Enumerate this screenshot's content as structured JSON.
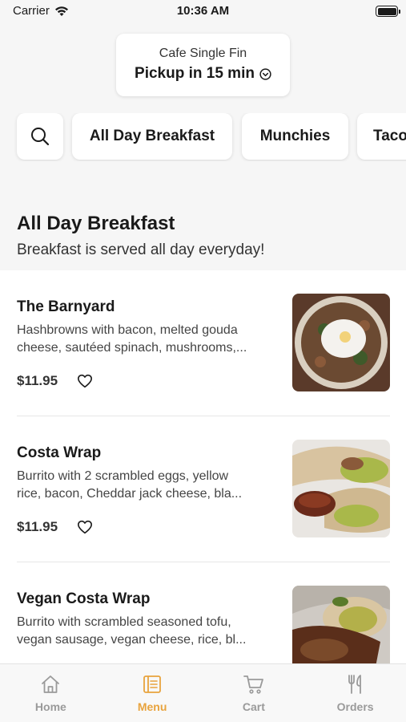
{
  "status": {
    "carrier": "Carrier",
    "time": "10:36 AM"
  },
  "location": {
    "name": "Cafe Single Fin",
    "pickup": "Pickup in 15 min"
  },
  "categories": [
    "All Day Breakfast",
    "Munchies",
    "Tacos"
  ],
  "section": {
    "title": "All Day Breakfast",
    "subtitle": "Breakfast is served all day everyday!"
  },
  "items": [
    {
      "name": "The Barnyard",
      "desc_line1": "Hashbrowns with bacon, melted gouda",
      "desc_line2": "cheese, sautéed spinach, mushrooms,...",
      "price": "$11.95"
    },
    {
      "name": "Costa Wrap",
      "desc_line1": "Burrito with 2 scrambled eggs, yellow",
      "desc_line2": "rice, bacon, Cheddar jack cheese, bla...",
      "price": "$11.95"
    },
    {
      "name": "Vegan Costa Wrap",
      "desc_line1": "Burrito with scrambled seasoned tofu,",
      "desc_line2": "vegan sausage, vegan cheese, rice, bl...",
      "price": ""
    }
  ],
  "tabs": [
    {
      "label": "Home",
      "icon": "home-icon",
      "active": false
    },
    {
      "label": "Menu",
      "icon": "menu-icon",
      "active": true
    },
    {
      "label": "Cart",
      "icon": "cart-icon",
      "active": false
    },
    {
      "label": "Orders",
      "icon": "orders-icon",
      "active": false
    }
  ],
  "colors": {
    "accent": "#e8a33d",
    "inactive": "#9a9a9a",
    "background": "#f6f6f6"
  }
}
